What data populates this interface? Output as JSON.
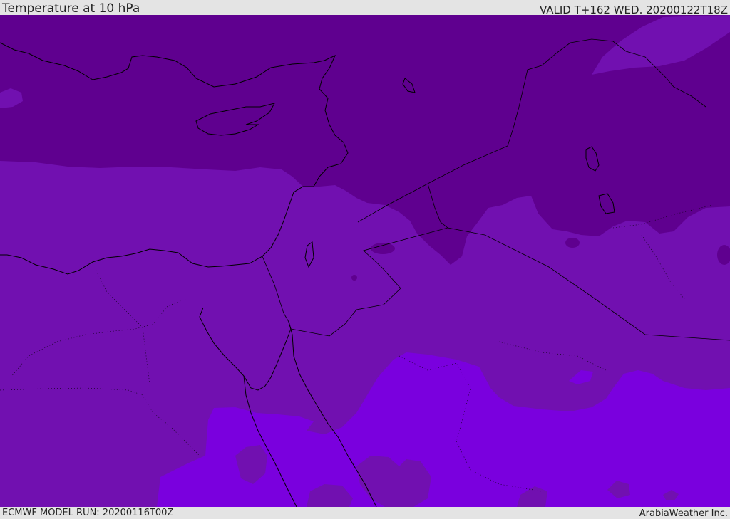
{
  "header": {
    "title": "Temperature at 10 hPa",
    "valid": "VALID T+162 WED. 20200122T18Z"
  },
  "footer": {
    "model_run": "ECMWF MODEL RUN: 20200116T00Z",
    "credit": "ArabiaWeather Inc."
  },
  "map": {
    "region": "Eastern Mediterranean / Middle East",
    "colors": {
      "coldest": "#5f008f",
      "cold": "#7110b0",
      "cool": "#7a00de",
      "border": "#000000"
    }
  }
}
